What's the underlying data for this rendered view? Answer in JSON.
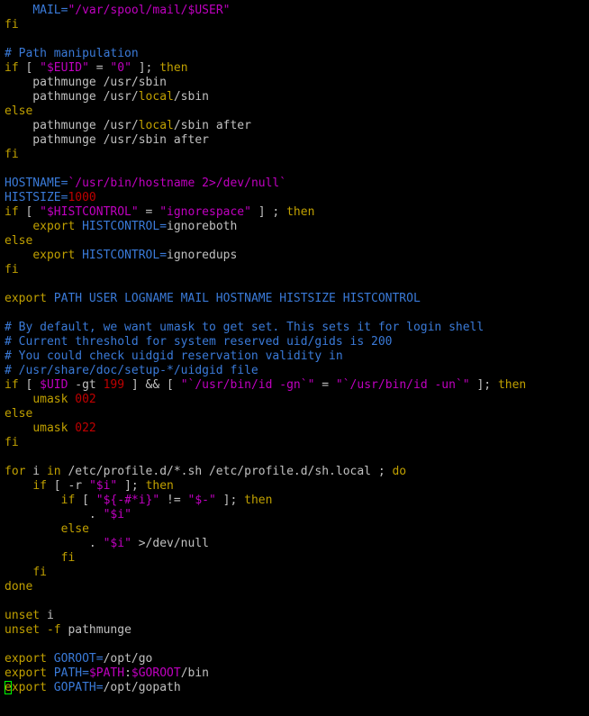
{
  "colors": {
    "background": "#000000",
    "plain": "#c0c0c0",
    "keyword": "#c0a000",
    "string": "#c000c0",
    "variable": "#c000c0",
    "number": "#c00000",
    "comment": "#3a7ad8",
    "builtin": "#3a7ad8",
    "cursor": "#00ff00"
  },
  "editor": {
    "lines": [
      [
        [
          "plain",
          "    "
        ],
        [
          "builtin",
          "MAIL="
        ],
        [
          "string",
          "\"/var/spool/mail/"
        ],
        [
          "variable",
          "$USER"
        ],
        [
          "string",
          "\""
        ]
      ],
      [
        [
          "keyword",
          "fi"
        ]
      ],
      [],
      [
        [
          "comment",
          "# Path manipulation"
        ]
      ],
      [
        [
          "keyword",
          "if"
        ],
        [
          "plain",
          " [ "
        ],
        [
          "string",
          "\""
        ],
        [
          "variable",
          "$EUID"
        ],
        [
          "string",
          "\""
        ],
        [
          "plain",
          " = "
        ],
        [
          "string",
          "\"0\""
        ],
        [
          "plain",
          " ]; "
        ],
        [
          "keyword",
          "then"
        ]
      ],
      [
        [
          "plain",
          "    pathmunge /usr/sbin"
        ]
      ],
      [
        [
          "plain",
          "    pathmunge /usr/"
        ],
        [
          "keyword",
          "local"
        ],
        [
          "plain",
          "/sbin"
        ]
      ],
      [
        [
          "keyword",
          "else"
        ]
      ],
      [
        [
          "plain",
          "    pathmunge /usr/"
        ],
        [
          "keyword",
          "local"
        ],
        [
          "plain",
          "/sbin after"
        ]
      ],
      [
        [
          "plain",
          "    pathmunge /usr/sbin after"
        ]
      ],
      [
        [
          "keyword",
          "fi"
        ]
      ],
      [],
      [
        [
          "builtin",
          "HOSTNAME="
        ],
        [
          "string",
          "`/usr/bin/hostname 2>/dev/null`"
        ]
      ],
      [
        [
          "builtin",
          "HISTSIZE="
        ],
        [
          "number",
          "1000"
        ]
      ],
      [
        [
          "keyword",
          "if"
        ],
        [
          "plain",
          " [ "
        ],
        [
          "string",
          "\""
        ],
        [
          "variable",
          "$HISTCONTROL"
        ],
        [
          "string",
          "\""
        ],
        [
          "plain",
          " = "
        ],
        [
          "string",
          "\"ignorespace\""
        ],
        [
          "plain",
          " ] ; "
        ],
        [
          "keyword",
          "then"
        ]
      ],
      [
        [
          "plain",
          "    "
        ],
        [
          "keyword",
          "export"
        ],
        [
          "plain",
          " "
        ],
        [
          "builtin",
          "HISTCONTROL="
        ],
        [
          "plain",
          "ignoreboth"
        ]
      ],
      [
        [
          "keyword",
          "else"
        ]
      ],
      [
        [
          "plain",
          "    "
        ],
        [
          "keyword",
          "export"
        ],
        [
          "plain",
          " "
        ],
        [
          "builtin",
          "HISTCONTROL="
        ],
        [
          "plain",
          "ignoredups"
        ]
      ],
      [
        [
          "keyword",
          "fi"
        ]
      ],
      [],
      [
        [
          "keyword",
          "export"
        ],
        [
          "plain",
          " "
        ],
        [
          "builtin",
          "PATH USER LOGNAME MAIL HOSTNAME HISTSIZE HISTCONTROL"
        ]
      ],
      [],
      [
        [
          "comment",
          "# By default, we want umask to get set. This sets it for login shell"
        ]
      ],
      [
        [
          "comment",
          "# Current threshold for system reserved uid/gids is 200"
        ]
      ],
      [
        [
          "comment",
          "# You could check uidgid reservation validity in"
        ]
      ],
      [
        [
          "comment",
          "# /usr/share/doc/setup-*/uidgid file"
        ]
      ],
      [
        [
          "keyword",
          "if"
        ],
        [
          "plain",
          " [ "
        ],
        [
          "variable",
          "$UID"
        ],
        [
          "plain",
          " -gt "
        ],
        [
          "number",
          "199"
        ],
        [
          "plain",
          " ] && [ "
        ],
        [
          "string",
          "\"`/usr/bin/id -gn`\""
        ],
        [
          "plain",
          " = "
        ],
        [
          "string",
          "\"`/usr/bin/id -un`\""
        ],
        [
          "plain",
          " ]; "
        ],
        [
          "keyword",
          "then"
        ]
      ],
      [
        [
          "plain",
          "    "
        ],
        [
          "keyword",
          "umask"
        ],
        [
          "plain",
          " "
        ],
        [
          "number",
          "002"
        ]
      ],
      [
        [
          "keyword",
          "else"
        ]
      ],
      [
        [
          "plain",
          "    "
        ],
        [
          "keyword",
          "umask"
        ],
        [
          "plain",
          " "
        ],
        [
          "number",
          "022"
        ]
      ],
      [
        [
          "keyword",
          "fi"
        ]
      ],
      [],
      [
        [
          "keyword",
          "for"
        ],
        [
          "plain",
          " i "
        ],
        [
          "keyword",
          "in"
        ],
        [
          "plain",
          " /etc/profile.d/*.sh /etc/profile.d/sh.local ; "
        ],
        [
          "keyword",
          "do"
        ]
      ],
      [
        [
          "plain",
          "    "
        ],
        [
          "keyword",
          "if"
        ],
        [
          "plain",
          " [ -r "
        ],
        [
          "string",
          "\""
        ],
        [
          "variable",
          "$i"
        ],
        [
          "string",
          "\""
        ],
        [
          "plain",
          " ]; "
        ],
        [
          "keyword",
          "then"
        ]
      ],
      [
        [
          "plain",
          "        "
        ],
        [
          "keyword",
          "if"
        ],
        [
          "plain",
          " [ "
        ],
        [
          "string",
          "\""
        ],
        [
          "variable",
          "${-#*i}"
        ],
        [
          "string",
          "\""
        ],
        [
          "plain",
          " != "
        ],
        [
          "string",
          "\""
        ],
        [
          "variable",
          "$-"
        ],
        [
          "string",
          "\""
        ],
        [
          "plain",
          " ]; "
        ],
        [
          "keyword",
          "then"
        ]
      ],
      [
        [
          "plain",
          "            . "
        ],
        [
          "string",
          "\""
        ],
        [
          "variable",
          "$i"
        ],
        [
          "string",
          "\""
        ]
      ],
      [
        [
          "plain",
          "        "
        ],
        [
          "keyword",
          "else"
        ]
      ],
      [
        [
          "plain",
          "            . "
        ],
        [
          "string",
          "\""
        ],
        [
          "variable",
          "$i"
        ],
        [
          "string",
          "\""
        ],
        [
          "plain",
          " >/dev/null"
        ]
      ],
      [
        [
          "plain",
          "        "
        ],
        [
          "keyword",
          "fi"
        ]
      ],
      [
        [
          "plain",
          "    "
        ],
        [
          "keyword",
          "fi"
        ]
      ],
      [
        [
          "keyword",
          "done"
        ]
      ],
      [],
      [
        [
          "keyword",
          "unset"
        ],
        [
          "plain",
          " i"
        ]
      ],
      [
        [
          "keyword",
          "unset"
        ],
        [
          "plain",
          " "
        ],
        [
          "keyword",
          "-f"
        ],
        [
          "plain",
          " pathmunge"
        ]
      ],
      [],
      [
        [
          "keyword",
          "export"
        ],
        [
          "plain",
          " "
        ],
        [
          "builtin",
          "GOROOT="
        ],
        [
          "plain",
          "/opt/go"
        ]
      ],
      [
        [
          "keyword",
          "export"
        ],
        [
          "plain",
          " "
        ],
        [
          "builtin",
          "PATH="
        ],
        [
          "variable",
          "$PATH"
        ],
        [
          "plain",
          ":"
        ],
        [
          "variable",
          "$GOROOT"
        ],
        [
          "plain",
          "/bin"
        ]
      ],
      [
        [
          "cursor",
          "e"
        ],
        [
          "keyword",
          "xport"
        ],
        [
          "plain",
          " "
        ],
        [
          "builtin",
          "GOPATH="
        ],
        [
          "plain",
          "/opt/gopath"
        ]
      ]
    ]
  }
}
